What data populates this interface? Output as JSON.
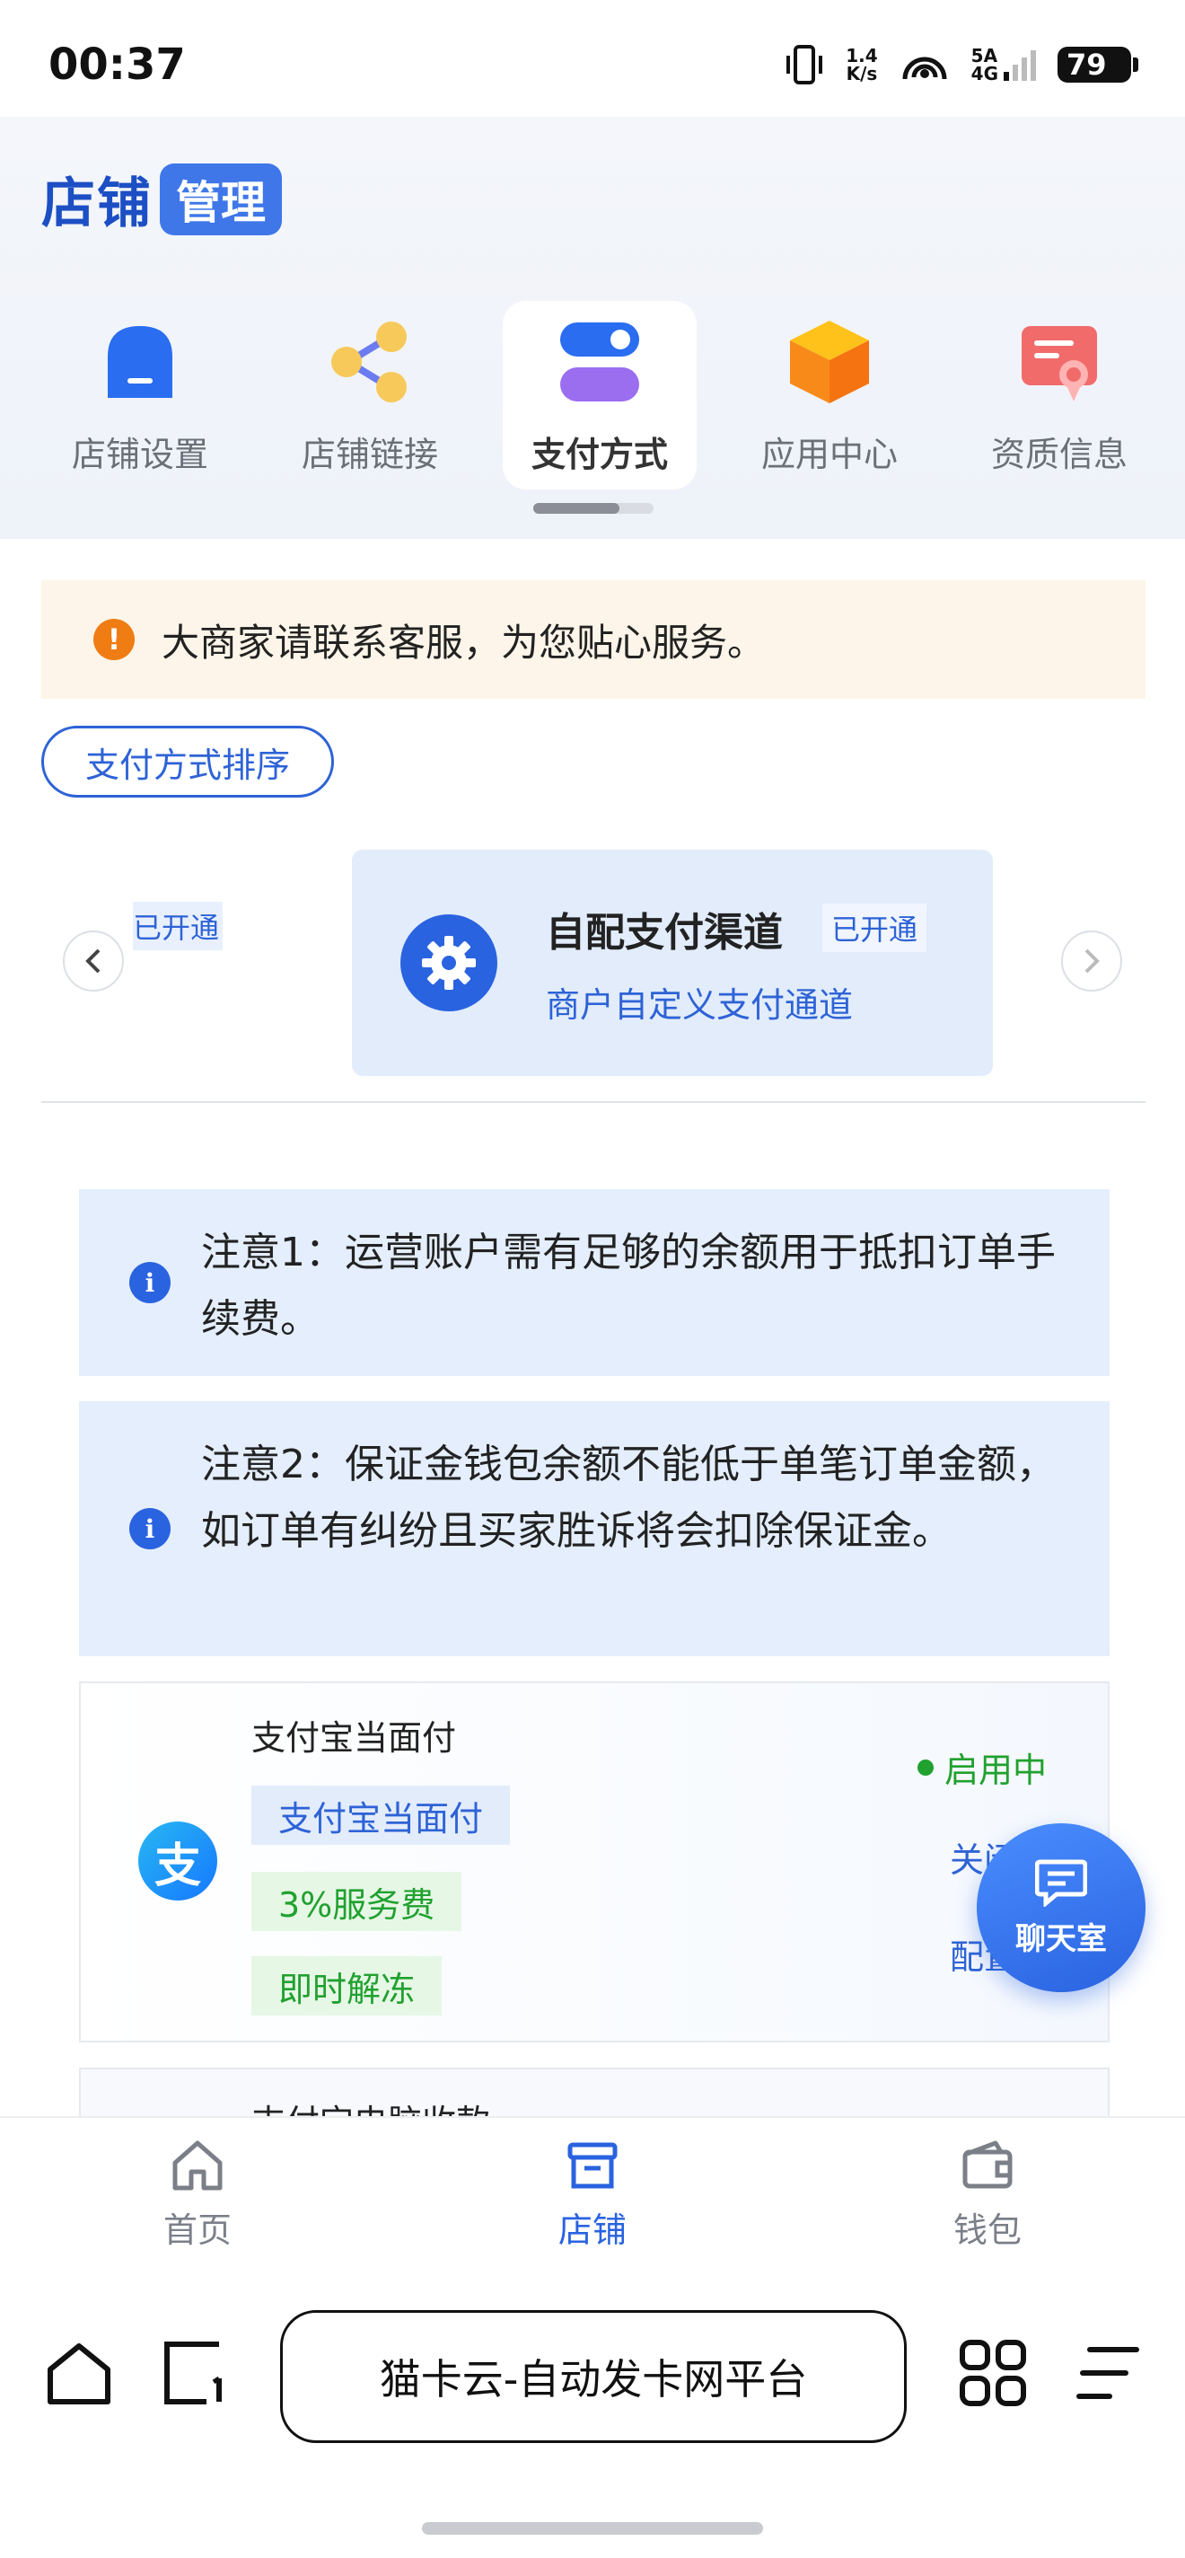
{
  "status_bar": {
    "time": "00:37",
    "speed_value": "1.4",
    "speed_unit": "K/s",
    "network_top": "5A",
    "network_bottom": "4G",
    "battery": "79"
  },
  "header": {
    "brand_main": "店铺",
    "brand_tag": "管理"
  },
  "nav_tiles": [
    {
      "label": "店铺设置",
      "icon": "store-icon"
    },
    {
      "label": "店铺链接",
      "icon": "share-icon"
    },
    {
      "label": "支付方式",
      "icon": "toggle-icon",
      "active": true
    },
    {
      "label": "应用中心",
      "icon": "cube-icon"
    },
    {
      "label": "资质信息",
      "icon": "certificate-icon"
    }
  ],
  "notice": {
    "icon_text": "!",
    "text": "大商家请联系客服，为您贴心服务。"
  },
  "sort_button": "支付方式排序",
  "carousel": {
    "peek_badge": "已开通",
    "channel": {
      "title": "自配支付渠道",
      "badge": "已开通",
      "description": "商户自定义支付通道"
    }
  },
  "info_notes": [
    {
      "icon_text": "i",
      "text": "注意1：运营账户需有足够的余额用于抵扣订单手续费。"
    },
    {
      "icon_text": "i",
      "text": "注意2：保证金钱包余额不能低于单笔订单金额，如订单有纠纷且买家胜诉将会扣除保证金。"
    }
  ],
  "payment_item": {
    "name": "支付宝当面付",
    "icon_text": "支",
    "tags": [
      "支付宝当面付",
      "3%服务费",
      "即时解冻"
    ],
    "status": "启用中",
    "action_close": "关闭",
    "action_config": "配置"
  },
  "next_payment_item": {
    "name": "支付宝电脑收款"
  },
  "chat_fab": {
    "label": "聊天室"
  },
  "tab_bar": [
    {
      "label": "首页",
      "icon": "home-icon"
    },
    {
      "label": "店铺",
      "icon": "shop-icon",
      "active": true
    },
    {
      "label": "钱包",
      "icon": "wallet-icon"
    }
  ],
  "browser": {
    "url_title": "猫卡云-自动发卡网平台"
  },
  "colors": {
    "primary": "#2a63e0",
    "success": "#21a12f",
    "warning": "#f07c14"
  }
}
